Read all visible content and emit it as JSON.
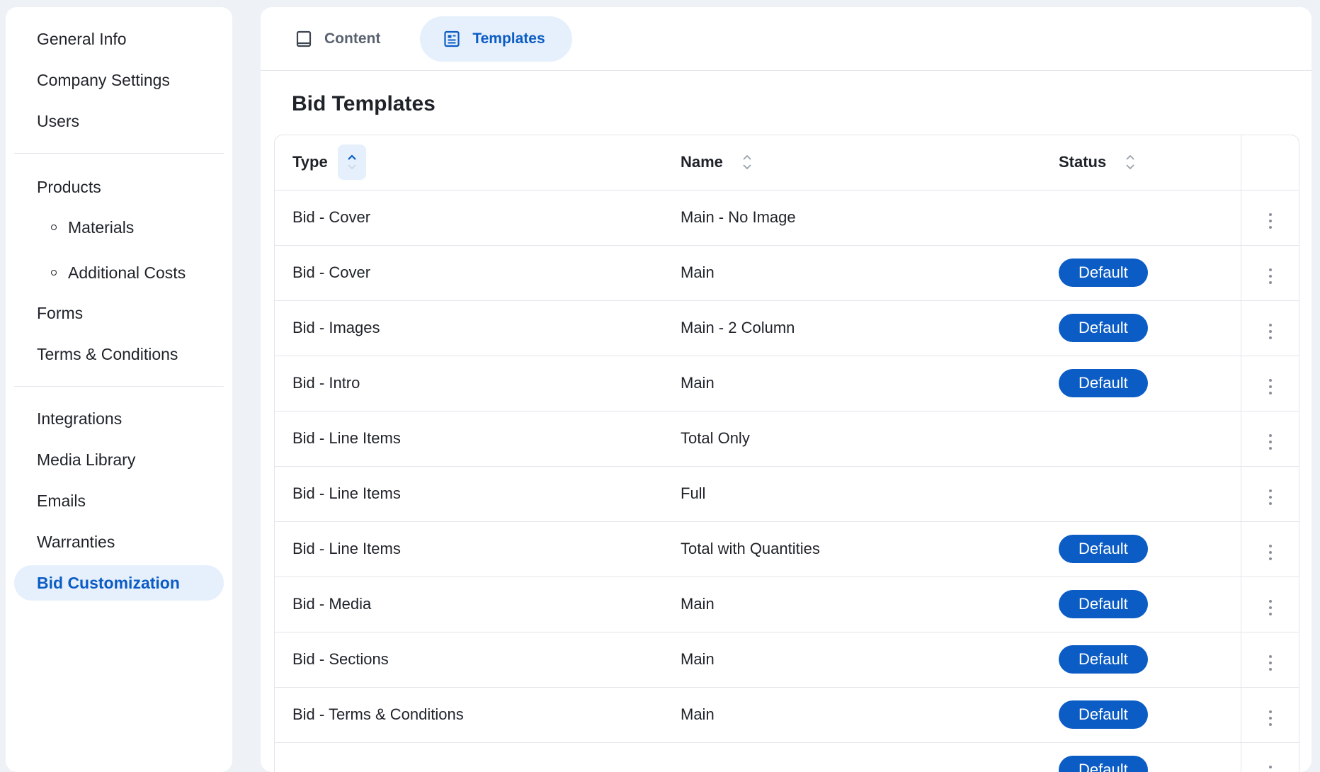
{
  "sidebar": {
    "group1": [
      "General Info",
      "Company Settings",
      "Users"
    ],
    "products": "Products",
    "products_sub": [
      "Materials",
      "Additional Costs"
    ],
    "group2_rest": [
      "Forms",
      "Terms & Conditions"
    ],
    "group3": [
      "Integrations",
      "Media Library",
      "Emails",
      "Warranties"
    ],
    "active_item": "Bid Customization"
  },
  "tabs": [
    {
      "label": "Content",
      "icon": "tablet-icon",
      "active": false
    },
    {
      "label": "Templates",
      "icon": "document-list-icon",
      "active": true
    }
  ],
  "page_title": "Bid Templates",
  "table": {
    "columns": {
      "type": "Type",
      "name": "Name",
      "status": "Status"
    },
    "sort": {
      "column": "Type",
      "direction": "ascending"
    },
    "rows": [
      {
        "type": "Bid - Cover",
        "name": "Main - No Image",
        "status": ""
      },
      {
        "type": "Bid - Cover",
        "name": "Main",
        "status": "Default"
      },
      {
        "type": "Bid - Images",
        "name": "Main - 2 Column",
        "status": "Default"
      },
      {
        "type": "Bid - Intro",
        "name": "Main",
        "status": "Default"
      },
      {
        "type": "Bid - Line Items",
        "name": "Total Only",
        "status": ""
      },
      {
        "type": "Bid - Line Items",
        "name": "Full",
        "status": ""
      },
      {
        "type": "Bid - Line Items",
        "name": "Total with Quantities",
        "status": "Default"
      },
      {
        "type": "Bid - Media",
        "name": "Main",
        "status": "Default"
      },
      {
        "type": "Bid - Sections",
        "name": "Main",
        "status": "Default"
      },
      {
        "type": "Bid - Terms & Conditions",
        "name": "Main",
        "status": "Default"
      },
      {
        "type": "",
        "name": "",
        "status": "Default"
      }
    ]
  },
  "colors": {
    "accent": "#0b5cc4",
    "accent_bg": "#e6f0fc",
    "page_bg": "#eef1f6"
  }
}
